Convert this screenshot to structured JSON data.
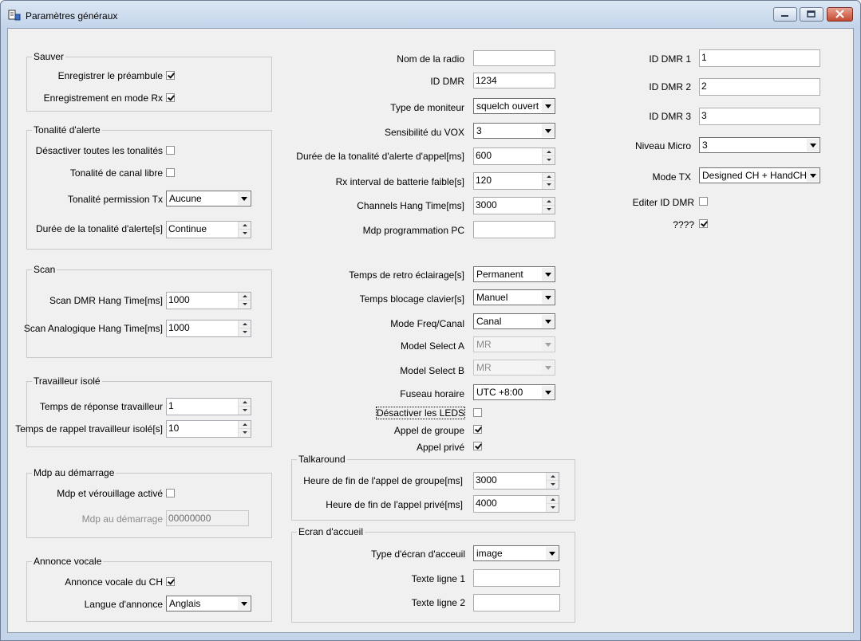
{
  "window": {
    "title": "Paramètres généraux"
  },
  "groups": {
    "sauver": {
      "title": "Sauver",
      "preamble_label": "Enregistrer le préambule",
      "preamble_checked": true,
      "rx_label": "Enregistrement en mode Rx",
      "rx_checked": true
    },
    "tonalite": {
      "title": "Tonalité d'alerte",
      "disable_all_label": "Désactiver toutes les tonalités",
      "disable_all_checked": false,
      "free_channel_label": "Tonalité de canal libre",
      "free_channel_checked": false,
      "tx_permit_label": "Tonalité permission Tx",
      "tx_permit_value": "Aucune",
      "duration_label": "Durée de la tonalité d'alerte[s]",
      "duration_value": "Continue"
    },
    "scan": {
      "title": "Scan",
      "dmr_label": "Scan DMR Hang Time[ms]",
      "dmr_value": "1000",
      "analog_label": "Scan Analogique Hang Time[ms]",
      "analog_value": "1000"
    },
    "travailleur": {
      "title": "Travailleur isolé",
      "response_label": "Temps de réponse travailleur",
      "response_value": "1",
      "reminder_label": "Temps de rappel travailleur isolé[s]",
      "reminder_value": "10"
    },
    "mdp": {
      "title": "Mdp au démarrage",
      "lock_label": "Mdp et vérouillage activé",
      "lock_checked": false,
      "pwd_label": "Mdp au démarrage",
      "pwd_value": "00000000"
    },
    "annonce": {
      "title": "Annonce vocale",
      "ch_label": "Annonce vocale du CH",
      "ch_checked": true,
      "lang_label": "Langue d'annonce",
      "lang_value": "Anglais"
    },
    "talkaround": {
      "title": "Talkaround",
      "group_end_label": "Heure de fin de l'appel de groupe[ms]",
      "group_end_value": "3000",
      "private_end_label": "Heure de fin de l'appel privé[ms]",
      "private_end_value": "4000"
    },
    "ecran": {
      "title": "Ecran d'accueil",
      "type_label": "Type d'écran d'acceuil",
      "type_value": "image",
      "line1_label": "Texte ligne 1",
      "line1_value": "",
      "line2_label": "Texte ligne 2",
      "line2_value": ""
    }
  },
  "middle": {
    "radio_name_label": "Nom de la radio",
    "radio_name_value": "",
    "dmr_id_label": "ID DMR",
    "dmr_id_value": "1234",
    "monitor_label": "Type de moniteur",
    "monitor_value": "squelch ouvert",
    "vox_label": "Sensibilité du VOX",
    "vox_value": "3",
    "call_tone_label": "Durée de la tonalité d'alerte d'appel[ms]",
    "call_tone_value": "600",
    "battery_label": "Rx interval de batterie faible[s]",
    "battery_value": "120",
    "hang_label": "Channels Hang Time[ms]",
    "hang_value": "3000",
    "pc_pwd_label": "Mdp programmation PC",
    "pc_pwd_value": "",
    "backlight_label": "Temps de retro éclairage[s]",
    "backlight_value": "Permanent",
    "keylock_label": "Temps blocage clavier[s]",
    "keylock_value": "Manuel",
    "freq_mode_label": "Mode Freq/Canal",
    "freq_mode_value": "Canal",
    "model_a_label": "Model Select A",
    "model_a_value": "MR",
    "model_b_label": "Model Select B",
    "model_b_value": "MR",
    "timezone_label": "Fuseau horaire",
    "timezone_value": "UTC +8:00",
    "leds_label": "Désactiver les LEDS",
    "leds_checked": false,
    "group_call_label": "Appel de groupe",
    "group_call_checked": true,
    "private_call_label": "Appel privé",
    "private_call_checked": true
  },
  "right": {
    "dmr1_label": "ID DMR 1",
    "dmr1_value": "1",
    "dmr2_label": "ID DMR 2",
    "dmr2_value": "2",
    "dmr3_label": "ID DMR 3",
    "dmr3_value": "3",
    "mic_label": "Niveau Micro",
    "mic_value": "3",
    "tx_mode_label": "Mode TX",
    "tx_mode_value": "Designed CH + HandCH",
    "edit_dmr_label": "Editer ID DMR",
    "edit_dmr_checked": false,
    "unknown_label": "????",
    "unknown_checked": true
  }
}
